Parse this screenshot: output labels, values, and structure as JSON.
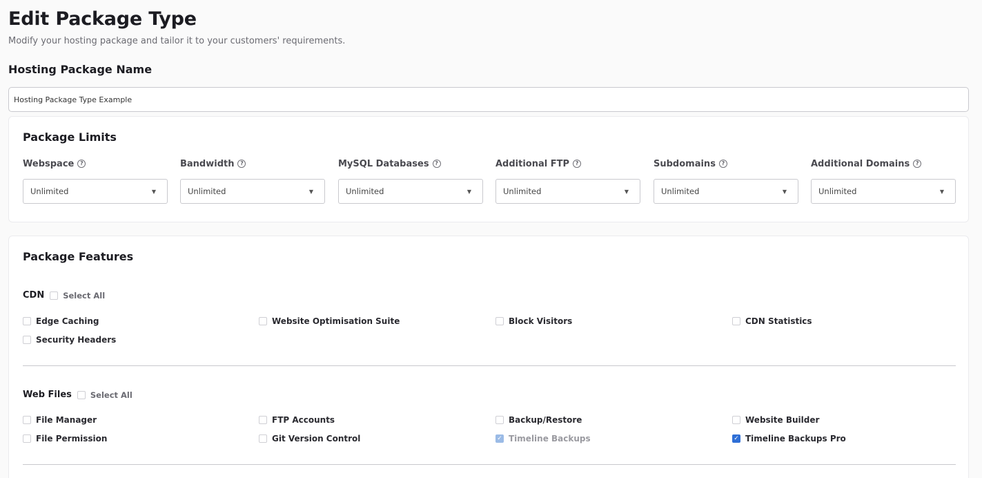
{
  "page": {
    "title": "Edit Package Type",
    "subtitle": "Modify your hosting package and tailor it to your customers' requirements."
  },
  "package_name": {
    "heading": "Hosting Package Name",
    "value": "Hosting Package Type Example"
  },
  "limits": {
    "title": "Package Limits",
    "fields": [
      {
        "label": "Webspace",
        "value": "Unlimited"
      },
      {
        "label": "Bandwidth",
        "value": "Unlimited"
      },
      {
        "label": "MySQL Databases",
        "value": "Unlimited"
      },
      {
        "label": "Additional FTP",
        "value": "Unlimited"
      },
      {
        "label": "Subdomains",
        "value": "Unlimited"
      },
      {
        "label": "Additional Domains",
        "value": "Unlimited"
      }
    ],
    "help_icon": "help-circle-icon",
    "caret_icon": "caret-down-icon"
  },
  "features": {
    "title": "Package Features",
    "select_all_label": "Select All",
    "sections": [
      {
        "name": "CDN",
        "select_all_checked": false,
        "items": [
          {
            "label": "Edge Caching",
            "checked": false,
            "disabled": false
          },
          {
            "label": "Website Optimisation Suite",
            "checked": false,
            "disabled": false
          },
          {
            "label": "Block Visitors",
            "checked": false,
            "disabled": false
          },
          {
            "label": "CDN Statistics",
            "checked": false,
            "disabled": false
          },
          {
            "label": "Security Headers",
            "checked": false,
            "disabled": false
          }
        ]
      },
      {
        "name": "Web Files",
        "select_all_checked": false,
        "items": [
          {
            "label": "File Manager",
            "checked": false,
            "disabled": false
          },
          {
            "label": "FTP Accounts",
            "checked": false,
            "disabled": false
          },
          {
            "label": "Backup/Restore",
            "checked": false,
            "disabled": false
          },
          {
            "label": "Website Builder",
            "checked": false,
            "disabled": false
          },
          {
            "label": "File Permission",
            "checked": false,
            "disabled": false
          },
          {
            "label": "Git Version Control",
            "checked": false,
            "disabled": false
          },
          {
            "label": "Timeline Backups",
            "checked": true,
            "disabled": true
          },
          {
            "label": "Timeline Backups Pro",
            "checked": true,
            "disabled": false
          }
        ]
      }
    ]
  },
  "colors": {
    "accent": "#2f6fd6",
    "accent_disabled": "#9bbbe6"
  }
}
